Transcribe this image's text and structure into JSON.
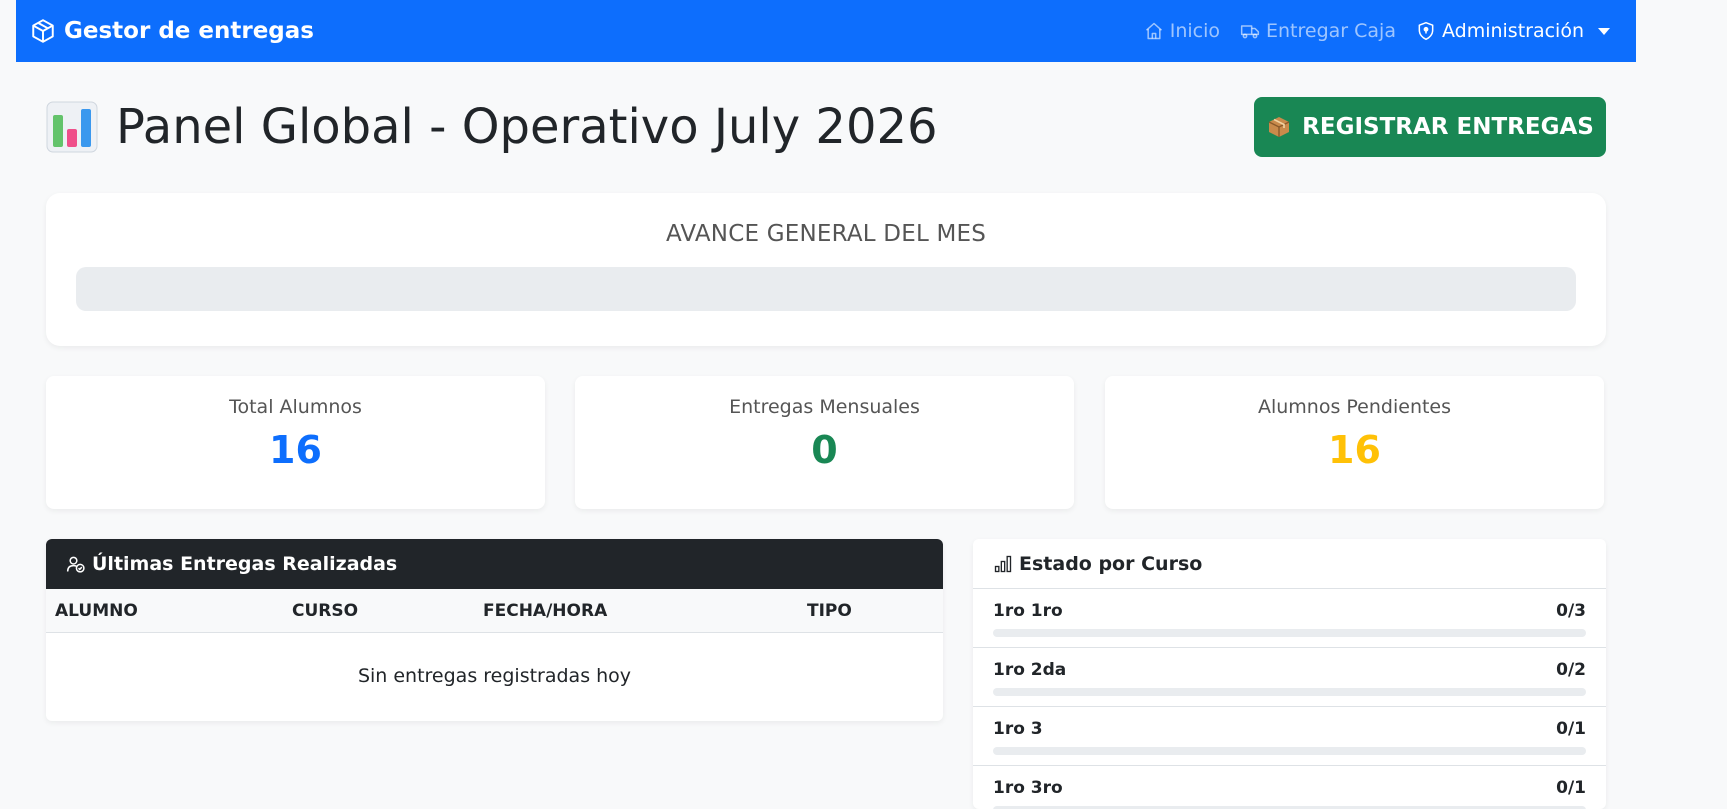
{
  "navbar": {
    "brand": "Gestor de entregas",
    "links": [
      {
        "label": "Inicio",
        "icon": "house-icon"
      },
      {
        "label": "Entregar Caja",
        "icon": "truck-icon"
      },
      {
        "label": "Administración",
        "icon": "shield-icon"
      }
    ]
  },
  "header": {
    "title": "Panel Global - Operativo July 2026",
    "register_button": "REGISTRAR ENTREGAS"
  },
  "progress": {
    "title": "AVANCE GENERAL DEL MES",
    "value": 0
  },
  "stats": [
    {
      "label": "Total Alumnos",
      "value": "16",
      "color": "#0d6efd"
    },
    {
      "label": "Entregas Mensuales",
      "value": "0",
      "color": "#198754"
    },
    {
      "label": "Alumnos Pendientes",
      "value": "16",
      "color": "#ffc107"
    }
  ],
  "deliveries": {
    "title": "Últimas Entregas Realizadas",
    "columns": [
      "ALUMNO",
      "CURSO",
      "FECHA/HORA",
      "TIPO"
    ],
    "empty_text": "Sin entregas registradas hoy"
  },
  "courses": {
    "title": "Estado por Curso",
    "items": [
      {
        "name": "1ro 1ro",
        "count": "0/3",
        "delivered": 0,
        "total": 3
      },
      {
        "name": "1ro 2da",
        "count": "0/2",
        "delivered": 0,
        "total": 2
      },
      {
        "name": "1ro 3",
        "count": "0/1",
        "delivered": 0,
        "total": 1
      },
      {
        "name": "1ro 3ro",
        "count": "0/1",
        "delivered": 0,
        "total": 1
      }
    ]
  }
}
